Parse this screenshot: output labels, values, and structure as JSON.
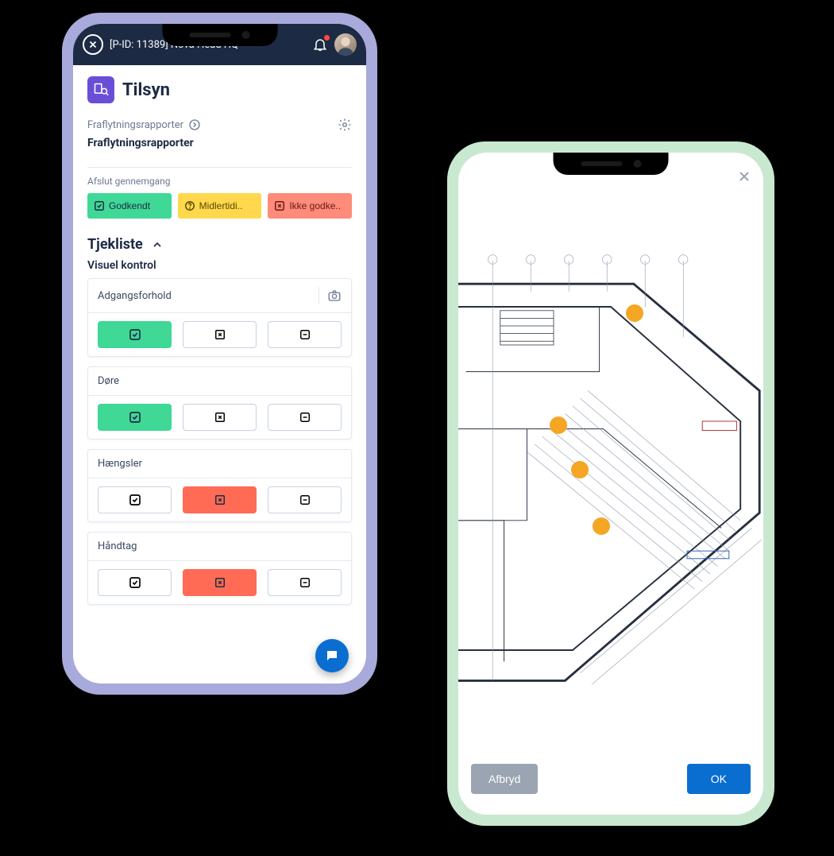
{
  "phone1": {
    "header": {
      "title": "[P-ID: 11389] Nova Head HQ"
    },
    "page": {
      "icon_name": "inspection-icon",
      "title": "Tilsyn",
      "breadcrumb": "Fraflytningsrapporter",
      "subtitle": "Fraflytningsrapporter"
    },
    "review": {
      "label": "Afslut gennemgang",
      "approved": "Godkendt",
      "temporary": "Midlertidi..",
      "rejected": "Ikke godke.."
    },
    "checklist": {
      "heading": "Tjekliste",
      "group_label": "Visuel kontrol",
      "items": [
        {
          "label": "Adgangsforhold",
          "selected": "green",
          "camera": true
        },
        {
          "label": "Døre",
          "selected": "green",
          "camera": false
        },
        {
          "label": "Hængsler",
          "selected": "red",
          "camera": false
        },
        {
          "label": "Håndtag",
          "selected": "red",
          "camera": false
        }
      ]
    }
  },
  "phone2": {
    "markers": [
      {
        "x": 55,
        "y": 20
      },
      {
        "x": 30,
        "y": 40
      },
      {
        "x": 37,
        "y": 48
      },
      {
        "x": 44,
        "y": 58
      }
    ],
    "buttons": {
      "cancel": "Afbryd",
      "ok": "OK"
    }
  }
}
